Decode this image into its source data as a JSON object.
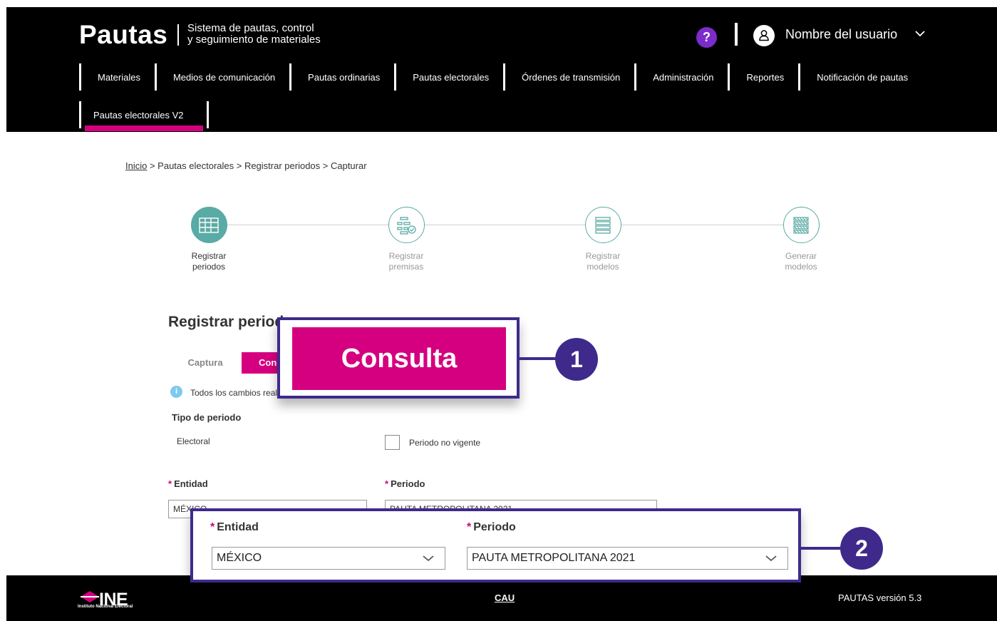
{
  "header": {
    "brand": "Pautas",
    "subtitle_line1": "Sistema de pautas, control",
    "subtitle_line2": "y seguimiento de materiales",
    "help_label": "?",
    "username": "Nombre del usuario"
  },
  "nav": {
    "row1": [
      {
        "label": "Materiales"
      },
      {
        "label": "Medios de comunicación"
      },
      {
        "label": "Pautas ordinarias"
      },
      {
        "label": "Pautas electorales"
      },
      {
        "label": "Órdenes de transmisión"
      },
      {
        "label": "Administración"
      },
      {
        "label": "Reportes"
      },
      {
        "label": "Notificación de pautas"
      }
    ],
    "row2": [
      {
        "label": "Pautas electorales V2"
      }
    ],
    "active_color": "#d5007f"
  },
  "breadcrumb": {
    "home": "Inicio",
    "rest": " > Pautas electorales > Registrar periodos > Capturar"
  },
  "steps": [
    {
      "line1": "Registrar",
      "line2": "periodos",
      "active": true
    },
    {
      "line1": "Registrar",
      "line2": "premisas",
      "active": false
    },
    {
      "line1": "Registrar",
      "line2": "modelos",
      "active": false
    },
    {
      "line1": "Generar",
      "line2": "modelos",
      "active": false
    }
  ],
  "form": {
    "title": "Registrar period",
    "tab_captura": "Captura",
    "tab_consulta": "Cons",
    "info": "Todos los cambios reali",
    "tipo_label": "Tipo de periodo",
    "tipo_value": "Electoral",
    "no_vigente_label": "Periodo no vigente",
    "entidad_label": "Entidad",
    "periodo_label": "Periodo",
    "entidad_value": "MÉXICO",
    "periodo_value": "PAUTA METROPOLITANA 2021",
    "required_mark": "*"
  },
  "callouts": {
    "one": {
      "number": "1",
      "label": "Consulta"
    },
    "two": {
      "number": "2",
      "entidad_label": "Entidad",
      "periodo_label": "Periodo",
      "entidad_value": "MÉXICO",
      "periodo_value": "PAUTA METROPOLITANA 2021"
    },
    "color": "#3f2a8c"
  },
  "footer": {
    "logo_text": "INE",
    "logo_sub": "Instituto Nacional Electoral",
    "cau": "CAU",
    "version": "PAUTAS versión 5.3"
  },
  "colors": {
    "teal": "#5aaaa5",
    "magenta": "#d5007f",
    "purple": "#3f2a8c",
    "help": "#7b2cc9"
  }
}
